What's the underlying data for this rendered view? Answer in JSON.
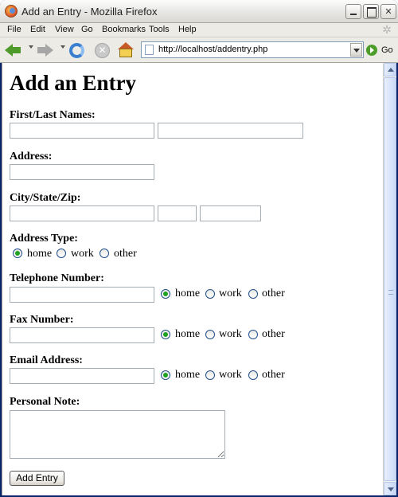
{
  "window": {
    "title": "Add an Entry - Mozilla Firefox"
  },
  "menu": [
    "File",
    "Edit",
    "View",
    "Go",
    "Bookmarks",
    "Tools",
    "Help"
  ],
  "toolbar": {
    "url": "http://localhost/addentry.php",
    "go_label": "Go"
  },
  "page": {
    "heading": "Add an Entry",
    "names_label": "First/Last Names:",
    "address_label": "Address:",
    "csz_label": "City/State/Zip:",
    "address_type": {
      "label": "Address Type:",
      "options": [
        "home",
        "work",
        "other"
      ],
      "selected": "home"
    },
    "telephone": {
      "label": "Telephone Number:",
      "options": [
        "home",
        "work",
        "other"
      ],
      "selected": "home"
    },
    "fax": {
      "label": "Fax Number:",
      "options": [
        "home",
        "work",
        "other"
      ],
      "selected": "home"
    },
    "email": {
      "label": "Email Address:",
      "options": [
        "home",
        "work",
        "other"
      ],
      "selected": "home"
    },
    "note_label": "Personal Note:",
    "submit_label": "Add Entry"
  },
  "icons": {
    "app": "firefox-icon",
    "back": "back-arrow-icon",
    "forward": "forward-arrow-icon",
    "reload": "reload-icon",
    "stop": "stop-icon",
    "home": "home-icon",
    "go": "go-icon"
  }
}
